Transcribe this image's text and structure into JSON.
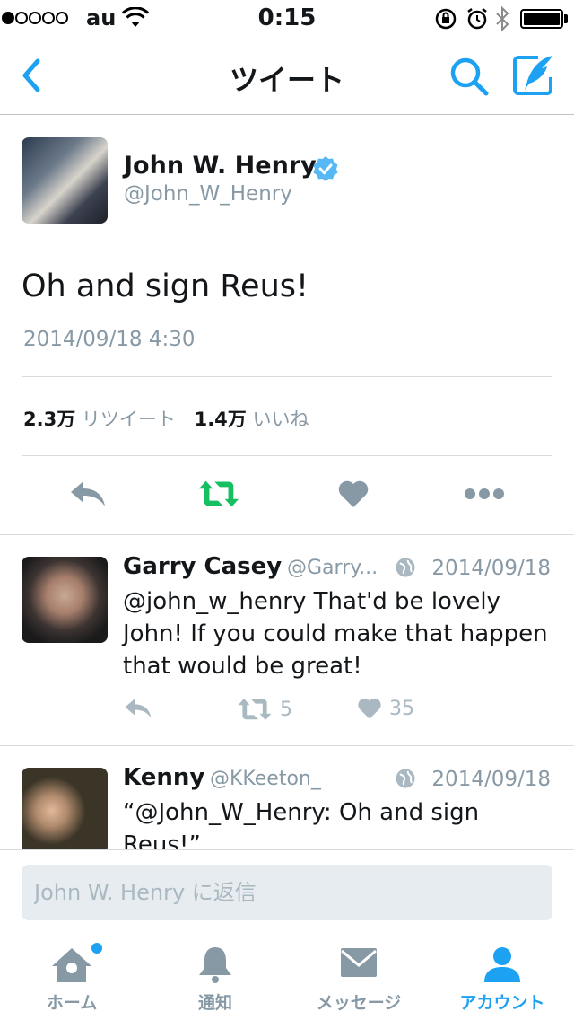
{
  "status_bar": {
    "carrier": "au",
    "time": "0:15"
  },
  "nav": {
    "title": "ツイート"
  },
  "tweet": {
    "author_name": "John W. Henry",
    "author_handle": "@John_W_Henry",
    "text": "Oh and sign Reus!",
    "date": "2014/09/18 4:30",
    "retweet_count": "2.3万",
    "retweet_label": "リツイート",
    "like_count": "1.4万",
    "like_label": "いいね"
  },
  "replies": [
    {
      "name": "Garry Casey",
      "handle": "@Garry...",
      "date": "2014/09/18",
      "text": "@john_w_henry That'd be lovely John! If you could make that happen that would be great!",
      "retweets": "5",
      "likes": "35"
    },
    {
      "name": "Kenny",
      "handle": "@KKeeton_",
      "date": "2014/09/18",
      "text": "“@John_W_Henry: Oh and sign Reus!”"
    }
  ],
  "compose": {
    "placeholder": "John W. Henry に返信"
  },
  "tabs": [
    {
      "label": "ホーム",
      "icon": "home-icon"
    },
    {
      "label": "通知",
      "icon": "bell-icon"
    },
    {
      "label": "メッセージ",
      "icon": "envelope-icon"
    },
    {
      "label": "アカウント",
      "icon": "person-icon"
    }
  ],
  "colors": {
    "accent": "#1da1f2",
    "retweet_active": "#17bf63",
    "muted": "#8899a6",
    "icon_gray": "#aab8c2"
  }
}
